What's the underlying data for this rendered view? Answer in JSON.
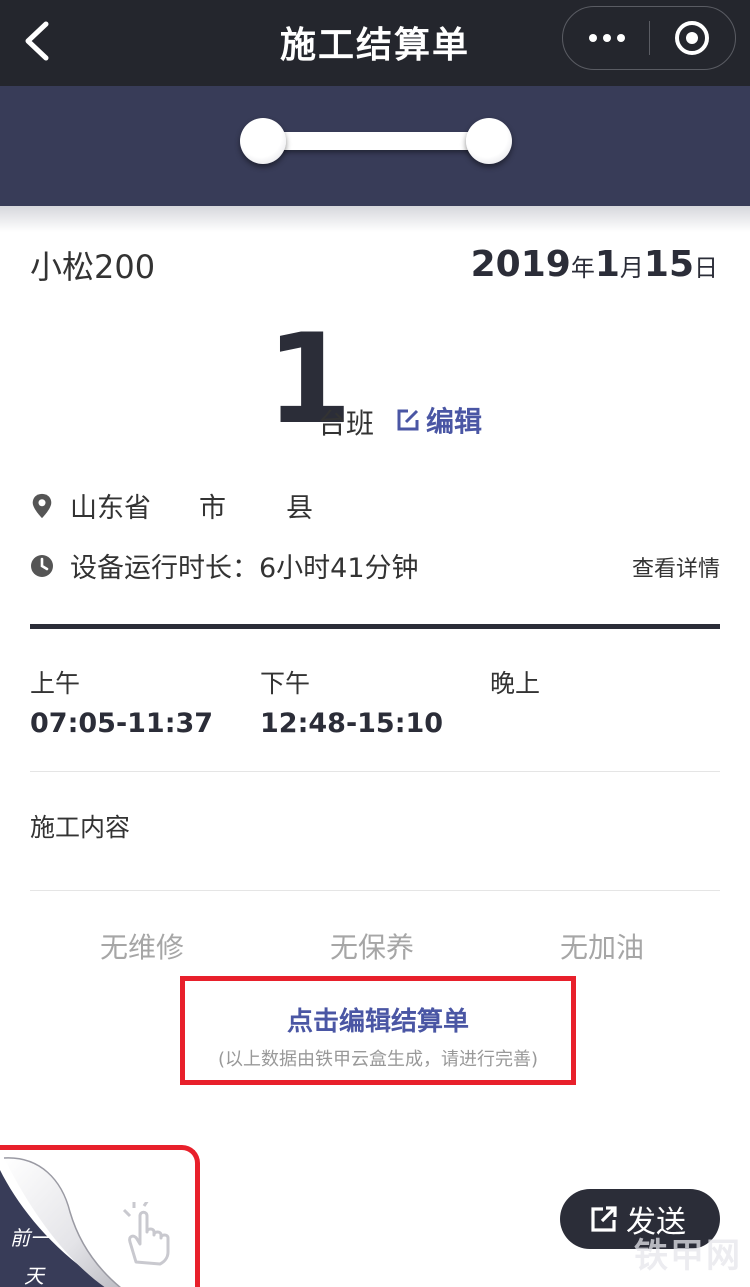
{
  "nav": {
    "title": "施工结算单"
  },
  "header": {
    "model": "小松200",
    "date": {
      "year": "2019",
      "year_unit": "年",
      "month": "1",
      "month_unit": "月",
      "day": "15",
      "day_unit": "日"
    }
  },
  "shift": {
    "count": "1",
    "unit": "台班",
    "edit_label": "编辑"
  },
  "location": {
    "province": "山东省",
    "city_suffix": "市",
    "county_suffix": "县"
  },
  "runtime": {
    "text": "设备运行时长：6小时41分钟",
    "detail_link": "查看详情"
  },
  "periods": [
    {
      "label": "上午",
      "time": "07:05-11:37"
    },
    {
      "label": "下午",
      "time": "12:48-15:10"
    },
    {
      "label": "晚上",
      "time": ""
    }
  ],
  "content_label": "施工内容",
  "statuses": [
    "无维修",
    "无保养",
    "无加油"
  ],
  "cta": {
    "title": "点击编辑结算单",
    "subtitle": "(以上数据由铁甲云盒生成，请进行完善)"
  },
  "page_curl": {
    "line1": "前一",
    "line2": "天"
  },
  "send_button": {
    "label": "发送"
  },
  "watermark": "铁甲网",
  "colors": {
    "navbar": "#24262d",
    "band": "#383c58",
    "accent": "#4a56a4",
    "highlight_border": "#e8202b",
    "dark_text": "#2b2d38"
  }
}
